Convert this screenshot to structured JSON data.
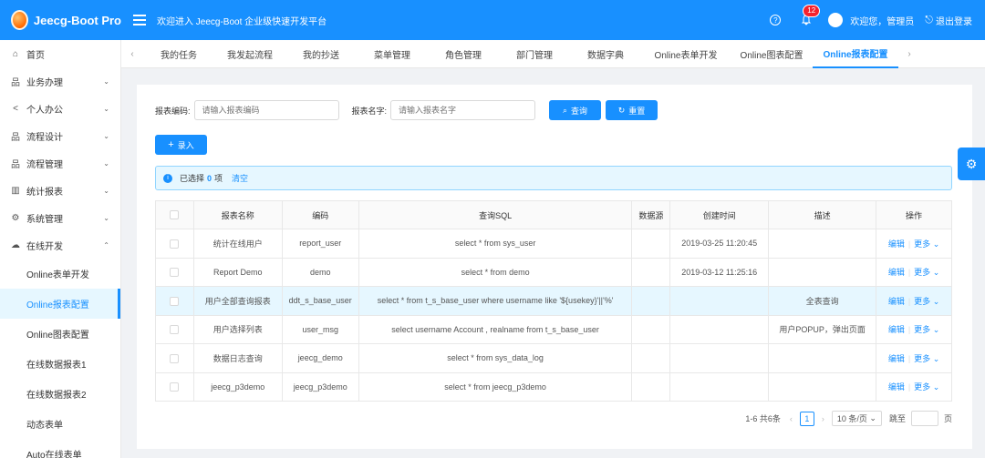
{
  "header": {
    "brand": "Jeecg-Boot Pro",
    "welcome": "欢迎进入 Jeecg-Boot 企业级快速开发平台",
    "notification_count": "12",
    "user_greeting": "欢迎您，管理员",
    "logout": "退出登录",
    "help_icon": "?"
  },
  "sidebar": {
    "items": [
      {
        "label": "首页",
        "icon": "home-icon"
      },
      {
        "label": "业务办理",
        "icon": "apps-icon"
      },
      {
        "label": "个人办公",
        "icon": "share-icon"
      },
      {
        "label": "流程设计",
        "icon": "apps-icon"
      },
      {
        "label": "流程管理",
        "icon": "apps-icon"
      },
      {
        "label": "统计报表",
        "icon": "bar-chart-icon"
      },
      {
        "label": "系统管理",
        "icon": "gear-icon"
      },
      {
        "label": "在线开发",
        "icon": "cloud-icon"
      }
    ],
    "sub_items": [
      {
        "label": "Online表单开发"
      },
      {
        "label": "Online报表配置"
      },
      {
        "label": "Online图表配置"
      },
      {
        "label": "在线数据报表1"
      },
      {
        "label": "在线数据报表2"
      },
      {
        "label": "动态表单"
      },
      {
        "label": "Auto在线表单"
      }
    ]
  },
  "tabs": [
    {
      "label": "我的任务"
    },
    {
      "label": "我发起流程"
    },
    {
      "label": "我的抄送"
    },
    {
      "label": "菜单管理"
    },
    {
      "label": "角色管理"
    },
    {
      "label": "部门管理"
    },
    {
      "label": "数据字典"
    },
    {
      "label": "Online表单开发"
    },
    {
      "label": "Online图表配置"
    },
    {
      "label": "Online报表配置"
    }
  ],
  "search": {
    "code_label": "报表编码:",
    "code_placeholder": "请输入报表编码",
    "name_label": "报表名字:",
    "name_placeholder": "请输入报表名字",
    "query": "查询",
    "reset": "重置"
  },
  "add_button": "录入",
  "selection": {
    "prefix": "已选择",
    "count": "0",
    "suffix": "项",
    "clear": "清空"
  },
  "table": {
    "headers": {
      "name": "报表名称",
      "code": "编码",
      "sql": "查询SQL",
      "ds": "数据源",
      "created": "创建时间",
      "desc": "描述",
      "ops": "操作"
    },
    "rows": [
      {
        "name": "统计在线用户",
        "code": "report_user",
        "sql": "select * from sys_user",
        "ds": "",
        "created": "2019-03-25 11:20:45",
        "desc": ""
      },
      {
        "name": "Report Demo",
        "code": "demo",
        "sql": "select * from demo",
        "ds": "",
        "created": "2019-03-12 11:25:16",
        "desc": ""
      },
      {
        "name": "用户全部查询报表",
        "code": "ddt_s_base_user",
        "sql": "select * from t_s_base_user where username like '${usekey}'||'%'",
        "ds": "",
        "created": "",
        "desc": "全表查询"
      },
      {
        "name": "用户选择列表",
        "code": "user_msg",
        "sql": "select username Account , realname from t_s_base_user",
        "ds": "",
        "created": "",
        "desc": "用户POPUP，弹出页面"
      },
      {
        "name": "数据日志查询",
        "code": "jeecg_demo",
        "sql": "select * from sys_data_log",
        "ds": "",
        "created": "",
        "desc": ""
      },
      {
        "name": "jeecg_p3demo",
        "code": "jeecg_p3demo",
        "sql": "select * from jeecg_p3demo",
        "ds": "",
        "created": "",
        "desc": ""
      }
    ],
    "edit": "编辑",
    "more": "更多"
  },
  "pagination": {
    "total": "1-6 共6条",
    "current": "1",
    "page_size": "10 条/页",
    "goto": "跳至",
    "page": "页"
  },
  "colors": {
    "primary": "#1890ff",
    "selected_row": "#e6f7ff"
  }
}
